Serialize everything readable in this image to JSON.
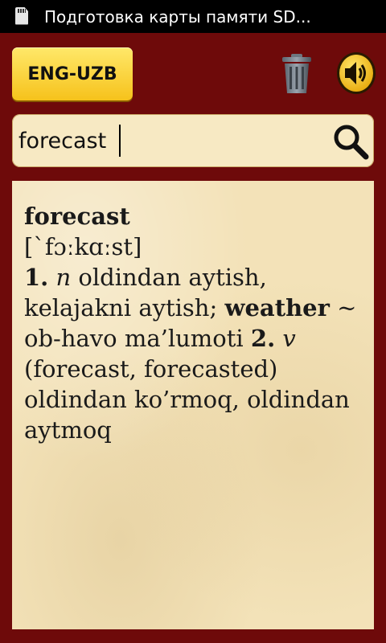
{
  "status_bar": {
    "icon": "sd-card-icon",
    "text": "Подготовка карты памяти SD..."
  },
  "toolbar": {
    "language_label": "ENG-UZB",
    "delete_icon": "trash-icon",
    "sound_icon": "speaker-icon"
  },
  "search": {
    "value": "forecast",
    "icon": "search-icon"
  },
  "entry": {
    "headword": "forecast",
    "pronunciation": "[`fɔːkɑːst]",
    "sense1_num": "1.",
    "sense1_pos": "n",
    "sense1_text": "oldindan aytish, kelajakni aytish;",
    "phrase_head": "weather",
    "phrase_text": "~ ob-havo ma’lumoti",
    "sense2_num": "2.",
    "sense2_pos": "v",
    "sense2_text": "(forecast, forecasted) oldindan ko’rmoq, oldindan aytmoq"
  },
  "colors": {
    "background": "#6e0a0a",
    "button_yellow": "#f6c21b",
    "paper": "#f3e2b8"
  }
}
